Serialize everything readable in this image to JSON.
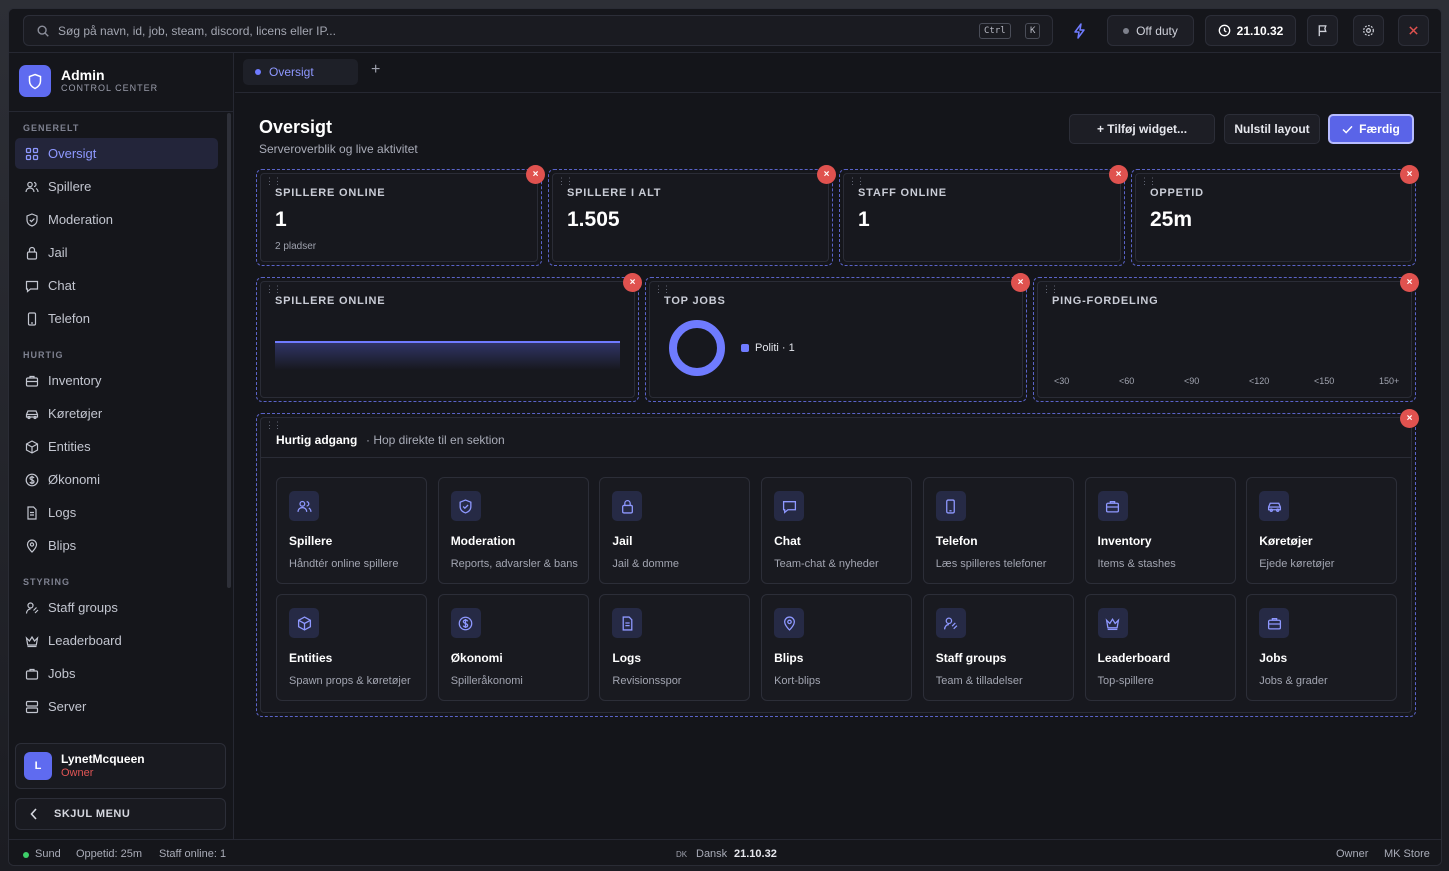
{
  "search": {
    "placeholder": "Søg på navn, id, job, steam, discord, licens eller IP...",
    "kbd1": "Ctrl",
    "kbd2": "K"
  },
  "topbar": {
    "status": "Off duty",
    "time": "21.10.32"
  },
  "brand": {
    "title": "Admin",
    "subtitle": "CONTROL CENTER"
  },
  "sidebar": {
    "sections": [
      "GENERELT",
      "HURTIG",
      "STYRING"
    ],
    "items": [
      {
        "label": "Oversigt",
        "icon": "grid-icon"
      },
      {
        "label": "Spillere",
        "icon": "users-icon"
      },
      {
        "label": "Moderation",
        "icon": "shield-icon"
      },
      {
        "label": "Jail",
        "icon": "lock-icon"
      },
      {
        "label": "Chat",
        "icon": "chat-icon"
      },
      {
        "label": "Telefon",
        "icon": "phone-icon"
      },
      {
        "label": "Inventory",
        "icon": "briefcase-icon"
      },
      {
        "label": "Køretøjer",
        "icon": "car-icon"
      },
      {
        "label": "Entities",
        "icon": "cube-icon"
      },
      {
        "label": "Økonomi",
        "icon": "dollar-icon"
      },
      {
        "label": "Logs",
        "icon": "file-icon"
      },
      {
        "label": "Blips",
        "icon": "pin-icon"
      },
      {
        "label": "Staff groups",
        "icon": "user-cog-icon"
      },
      {
        "label": "Leaderboard",
        "icon": "crown-icon"
      },
      {
        "label": "Jobs",
        "icon": "briefcase-icon"
      },
      {
        "label": "Server",
        "icon": "server-icon"
      }
    ]
  },
  "user": {
    "initial": "L",
    "name": "LynetMcqueen",
    "role": "Owner"
  },
  "hide_menu": "SKJUL MENU",
  "tabs": [
    {
      "label": "Oversigt"
    }
  ],
  "page": {
    "title": "Oversigt",
    "subtitle": "Serveroverblik og live aktivitet"
  },
  "header_buttons": {
    "add": "+ Tilføj widget...",
    "reset": "Nulstil layout",
    "done": "Færdig"
  },
  "stats": [
    {
      "label": "SPILLERE ONLINE",
      "value": "1",
      "note": "2 pladser"
    },
    {
      "label": "SPILLERE I ALT",
      "value": "1.505"
    },
    {
      "label": "STAFF ONLINE",
      "value": "1"
    },
    {
      "label": "OPPETID",
      "value": "25m"
    }
  ],
  "widgets": {
    "players_online": {
      "label": "SPILLERE ONLINE"
    },
    "top_jobs": {
      "label": "TOP JOBS",
      "legend": "Politi · 1"
    },
    "ping": {
      "label": "PING-FORDELING",
      "buckets": [
        "<30",
        "<60",
        "<90",
        "<120",
        "<150",
        "150+"
      ]
    }
  },
  "chart_data": [
    {
      "type": "area",
      "title": "SPILLERE ONLINE",
      "x": [],
      "values": []
    },
    {
      "type": "pie",
      "title": "TOP JOBS",
      "categories": [
        "Politi"
      ],
      "values": [
        1
      ]
    },
    {
      "type": "bar",
      "title": "PING-FORDELING",
      "categories": [
        "<30",
        "<60",
        "<90",
        "<120",
        "<150",
        "150+"
      ],
      "values": [
        0,
        0,
        0,
        0,
        0,
        0
      ]
    }
  ],
  "quick": {
    "title": "Hurtig adgang",
    "subtitle": "· Hop direkte til en sektion",
    "items": [
      {
        "title": "Spillere",
        "sub": "Håndtér online spillere",
        "icon": "users-icon"
      },
      {
        "title": "Moderation",
        "sub": "Reports, advarsler & bans",
        "icon": "shield-icon"
      },
      {
        "title": "Jail",
        "sub": "Jail & domme",
        "icon": "lock-icon"
      },
      {
        "title": "Chat",
        "sub": "Team-chat & nyheder",
        "icon": "chat-icon"
      },
      {
        "title": "Telefon",
        "sub": "Læs spilleres telefoner",
        "icon": "phone-icon"
      },
      {
        "title": "Inventory",
        "sub": "Items & stashes",
        "icon": "briefcase-icon"
      },
      {
        "title": "Køretøjer",
        "sub": "Ejede køretøjer",
        "icon": "car-icon"
      },
      {
        "title": "Entities",
        "sub": "Spawn props & køretøjer",
        "icon": "cube-icon"
      },
      {
        "title": "Økonomi",
        "sub": "Spilleråkonomi",
        "icon": "dollar-icon"
      },
      {
        "title": "Logs",
        "sub": "Revisionsspor",
        "icon": "file-icon"
      },
      {
        "title": "Blips",
        "sub": "Kort-blips",
        "icon": "pin-icon"
      },
      {
        "title": "Staff groups",
        "sub": "Team & tilladelser",
        "icon": "user-cog-icon"
      },
      {
        "title": "Leaderboard",
        "sub": "Top-spillere",
        "icon": "crown-icon"
      },
      {
        "title": "Jobs",
        "sub": "Jobs & grader",
        "icon": "briefcase-icon"
      }
    ]
  },
  "footer": {
    "health": "Sund",
    "uptime": "Oppetid: 25m",
    "staff": "Staff online: 1",
    "flag": "DK",
    "lang": "Dansk",
    "time": "21.10.32",
    "role": "Owner",
    "store": "MK Store"
  },
  "colors": {
    "accent": "#5f6bf0",
    "danger": "#e0524f",
    "health": "#3ecf6a"
  }
}
